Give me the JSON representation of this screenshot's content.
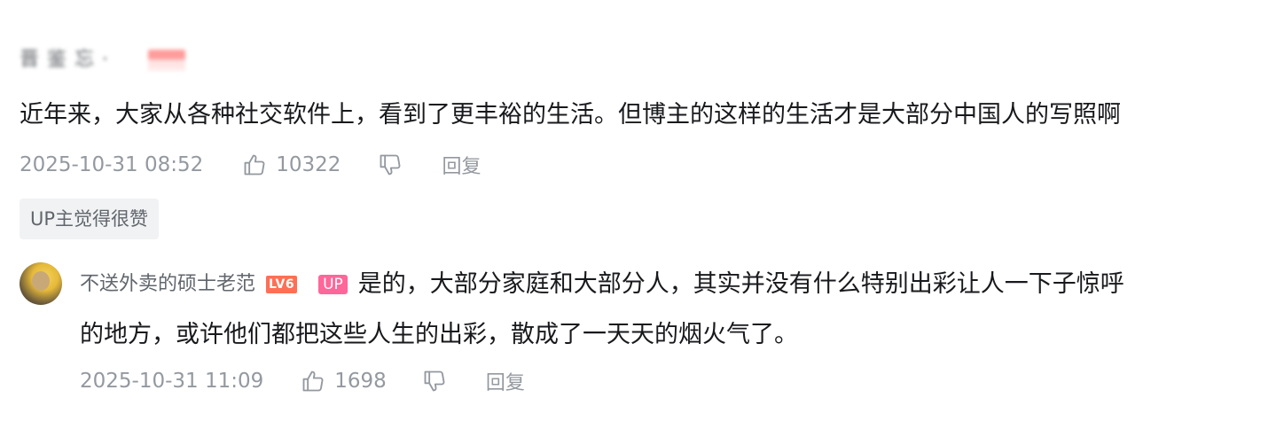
{
  "main_comment": {
    "username": "晋 鉴 忘 ·",
    "text": "近年来，大家从各种社交软件上，看到了更丰裕的生活。但博主的这样的生活才是大部分中国人的写照啊",
    "date": "2025-10-31 08:52",
    "like_count": "10322",
    "reply_label": "回复",
    "up_liked_label": "UP主觉得很赞"
  },
  "reply": {
    "username": "不送外卖的硕士老范",
    "level_badge": "LV6",
    "up_badge": "UP",
    "text_line1": "是的，大部分家庭和大部分人，其实并没有什么特别出彩让人一下子惊呼",
    "text_line2": "的地方，或许他们都把这些人生的出彩，散成了一天天的烟火气了。",
    "date": "2025-10-31 11:09",
    "like_count": "1698",
    "reply_label": "回复"
  },
  "icons": {
    "like": "thumbs-up-icon",
    "dislike": "thumbs-down-icon"
  },
  "colors": {
    "meta_text": "#9499a0",
    "level_badge": "#fe6f55",
    "up_badge": "#ff6699",
    "tag_background": "#f1f2f3"
  }
}
